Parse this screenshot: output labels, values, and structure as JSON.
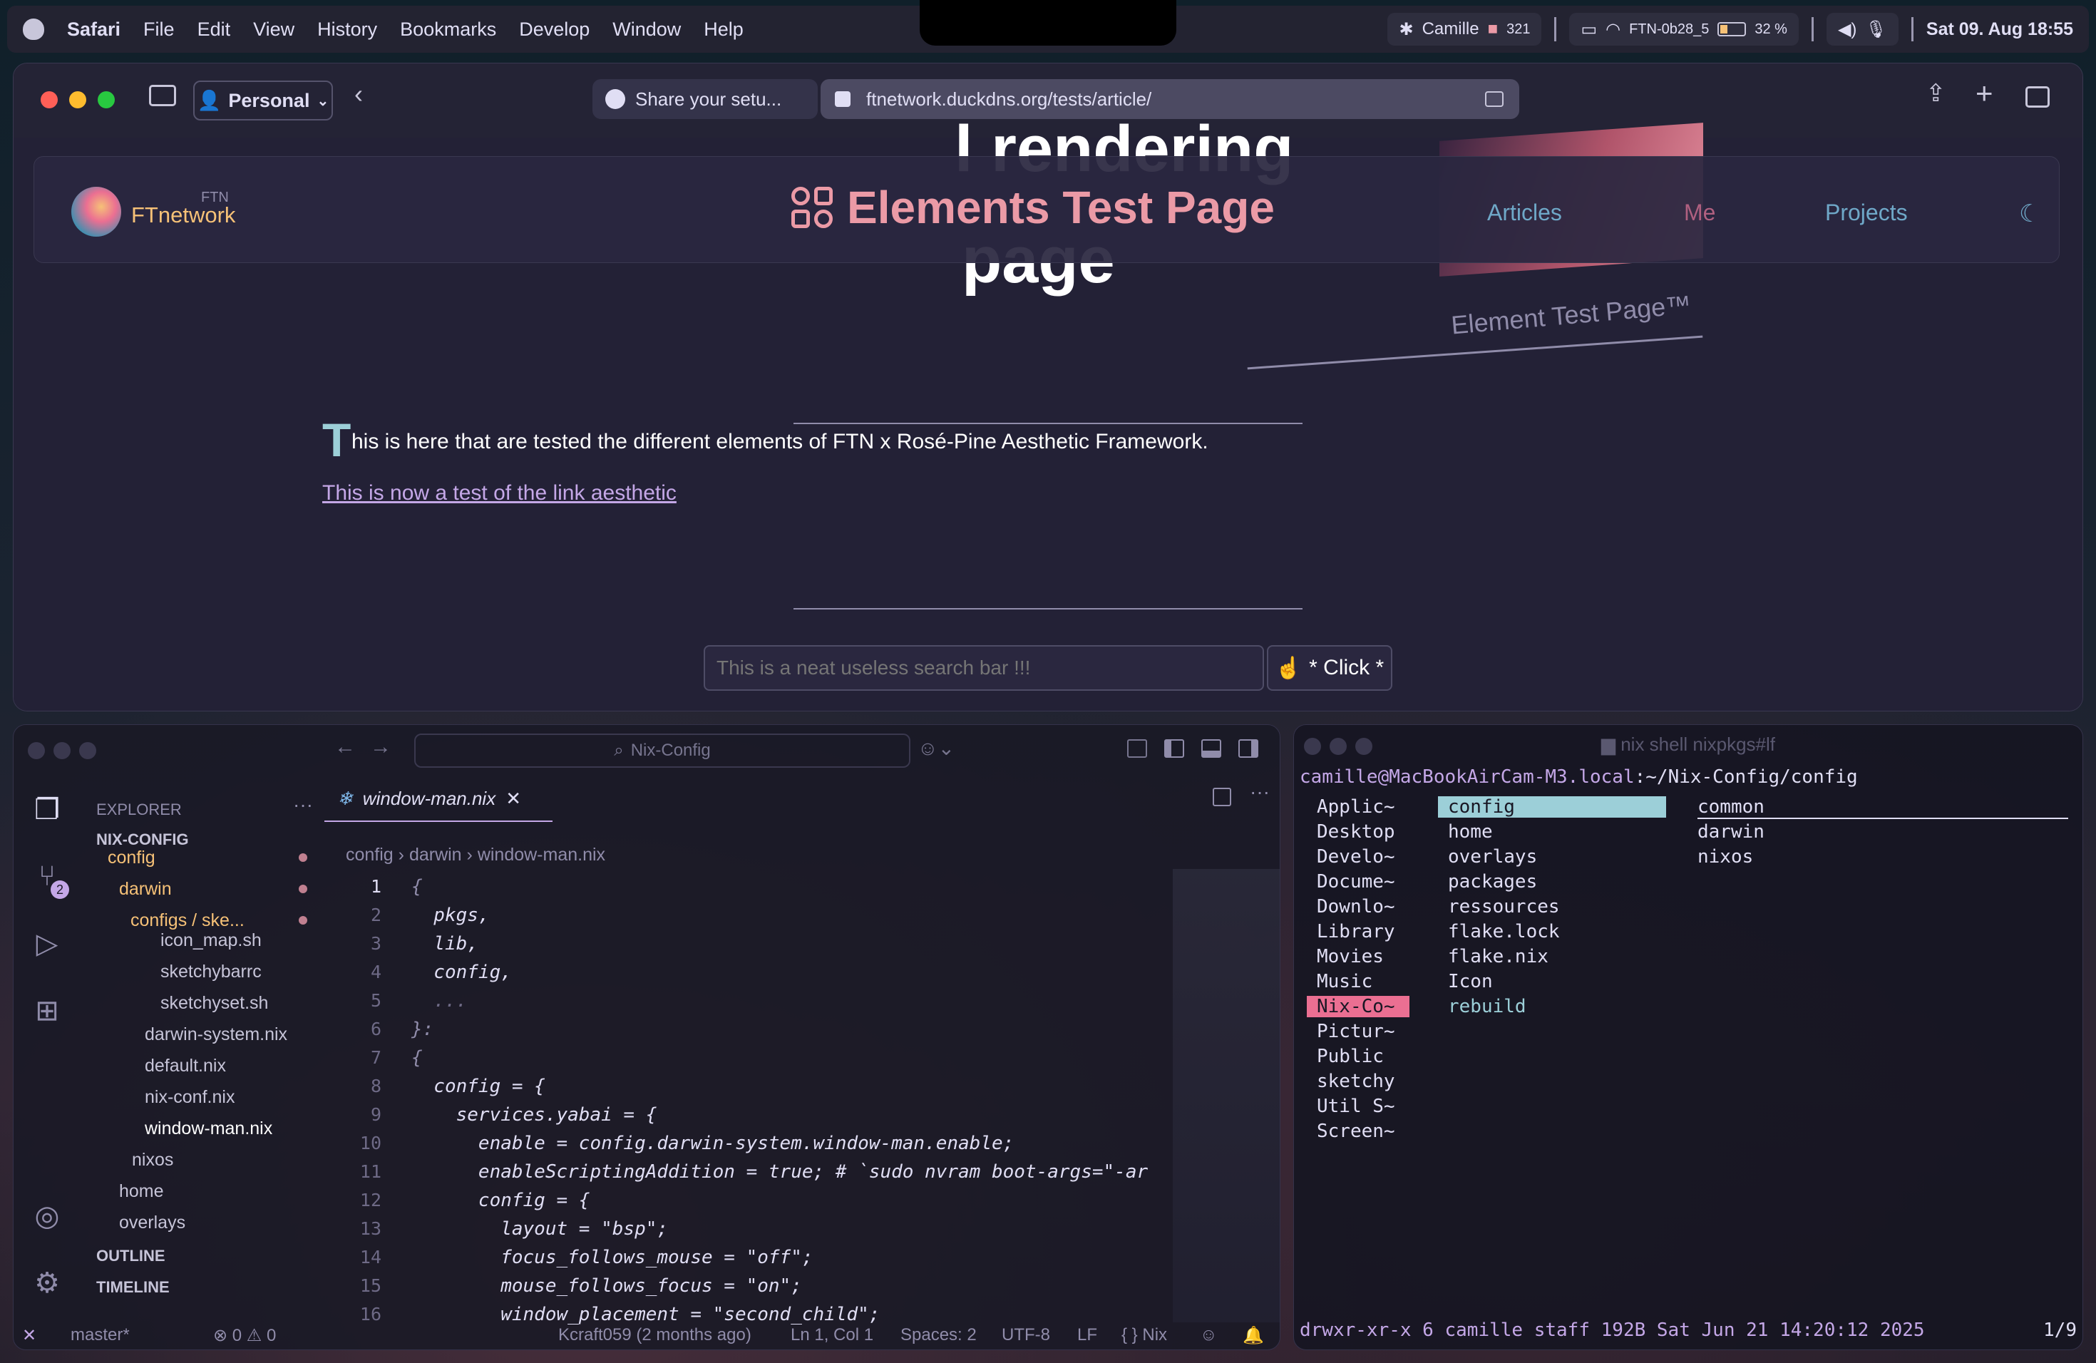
{
  "menubar": {
    "app": "Safari",
    "items": [
      "File",
      "Edit",
      "View",
      "History",
      "Bookmarks",
      "Develop",
      "Window",
      "Help"
    ],
    "status": {
      "user": "Camille",
      "count": "321",
      "wifi": "FTN-0b28_5",
      "battery": "32 %",
      "datetime": "Sat 09. Aug  18:55"
    }
  },
  "safari": {
    "profile": "Personal",
    "tab": "Share your setu...",
    "url": "ftnetwork.duckdns.org/tests/article/"
  },
  "site": {
    "logo_tag": "FTN",
    "logo_name": "FTnetwork",
    "title": "Elements Test Page",
    "nav": [
      "Articles",
      "Me",
      "Projects"
    ],
    "hero_word_top": "l rendering",
    "hero_word": "page",
    "tagline": "Element Test Page™",
    "dropcap": "T",
    "paragraph": "his is here that are tested the different elements of FTN x Rosé-Pine Aesthetic Framework.",
    "link": "This is now a test of the link aesthetic",
    "search_placeholder": "This is a neat useless search bar !!!",
    "button": "* Click *"
  },
  "vscode": {
    "search": "Nix-Config",
    "explorer_title": "EXPLORER",
    "scm_badge": "2",
    "tree": [
      "NIX-CONFIG",
      "config",
      "darwin",
      "configs / ske...",
      "icon_map.sh",
      "sketchybarrc",
      "sketchyset.sh",
      "darwin-system.nix",
      "default.nix",
      "nix-conf.nix",
      "window-man.nix",
      "nixos",
      "home",
      "overlays"
    ],
    "outline": "OUTLINE",
    "timeline": "TIMELINE",
    "tab": "window-man.nix",
    "breadcrumb": [
      "config",
      "darwin",
      "window-man.nix"
    ],
    "lines": [
      "{",
      "  pkgs,",
      "  lib,",
      "  config,",
      "  ...",
      "}:",
      "{",
      "  config = {",
      "    services.yabai = {",
      "      enable = config.darwin-system.window-man.enable;",
      "      enableScriptingAddition = true; # `sudo nvram boot-args=\"-ar",
      "      config = {",
      "        layout = \"bsp\";",
      "        focus_follows_mouse = \"off\";",
      "        mouse_follows_focus = \"on\";",
      "        window_placement = \"second_child\";"
    ],
    "line_numbers": [
      "1",
      "2",
      "3",
      "4",
      "5",
      "6",
      "7",
      "8",
      "9",
      "10",
      "11",
      "12",
      "13",
      "14",
      "15",
      "16"
    ],
    "status": {
      "branch": "master*",
      "problems": "⊗ 0 ⚠ 0",
      "blame": "Kcraft059 (2 months ago)",
      "pos": "Ln 1, Col 1",
      "spaces": "Spaces: 2",
      "enc": "UTF-8",
      "eol": "LF",
      "lang": "{ } Nix"
    }
  },
  "terminal": {
    "title": "nix shell nixpkgs#lf",
    "prompt_user": "camille@MacBookAirCam-M3.local",
    "prompt_path": ":~/Nix-Config/config",
    "col1": [
      "Applic~",
      "Desktop",
      "Develo~",
      "Docume~",
      "Downlo~",
      "Library",
      "Movies",
      "Music",
      "Nix-Co~",
      "Pictur~",
      "Public",
      "sketchy",
      "Util S~",
      "Screen~"
    ],
    "col2": [
      "config",
      "home",
      "overlays",
      "packages",
      "ressources",
      "flake.lock",
      "flake.nix",
      "Icon",
      "rebuild"
    ],
    "col3": [
      "common",
      "darwin",
      "nixos"
    ],
    "statusline": "drwxr-xr-x 6 camille staff 192B Sat Jun 21 14:20:12 2025",
    "counter": "1/9"
  },
  "colors": {
    "accent": "#c4a7e7",
    "rose": "#eb6f92",
    "gold": "#f6c177",
    "foam": "#9ccfd8",
    "base": "#232136"
  }
}
